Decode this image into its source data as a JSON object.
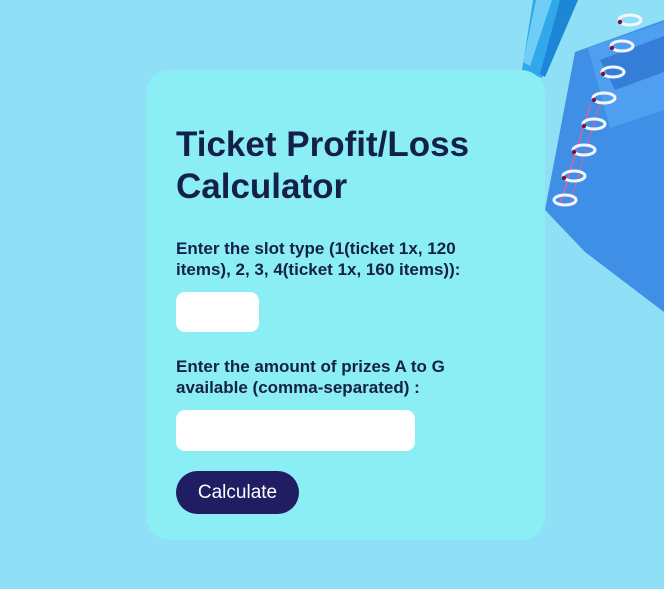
{
  "calculator": {
    "title": "Ticket Profit/Loss Calculator",
    "slot_type_label": "Enter the slot type (1(ticket 1x, 120 items), 2, 3, 4(ticket 1x, 160 items)):",
    "slot_type_value": "",
    "prizes_label": "Enter the amount of prizes A to G available (comma-separated) :",
    "prizes_value": "",
    "calculate_button": "Calculate"
  },
  "colors": {
    "background": "#8fe0f7",
    "card": "#8aeef4",
    "text": "#14204a",
    "button": "#211d62",
    "notebook": "#3d8ee8",
    "pen": "#2fa9ec"
  },
  "background_image": {
    "objects": [
      "pen",
      "spiral-notebook"
    ]
  }
}
